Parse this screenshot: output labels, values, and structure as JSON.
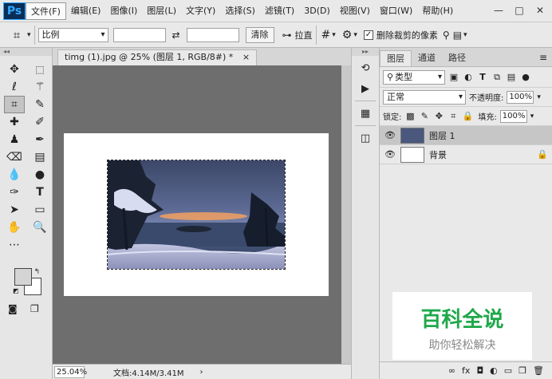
{
  "app": {
    "logo": "Ps"
  },
  "menu": [
    "文件(F)",
    "编辑(E)",
    "图像(I)",
    "图层(L)",
    "文字(Y)",
    "选择(S)",
    "滤镜(T)",
    "3D(D)",
    "视图(V)",
    "窗口(W)",
    "帮助(H)"
  ],
  "window_controls": [
    "—",
    "□",
    "✕"
  ],
  "options": {
    "ratio_select": "比例",
    "clear_button": "清除",
    "straighten_label": "拉直",
    "delete_cropped_label": "删除裁剪的像素",
    "delete_cropped_checked": true
  },
  "document": {
    "tab_title": "timg (1).jpg @ 25% (图层 1, RGB/8#) *",
    "tab_close": "×"
  },
  "status": {
    "zoom": "25.04%",
    "doc_info": "文档:4.14M/3.41M",
    "arrow": "›"
  },
  "panels": {
    "tabs": [
      "图层",
      "通道",
      "路径"
    ],
    "filter_label": "类型",
    "blend_mode": "正常",
    "opacity_label": "不透明度:",
    "opacity_value": "100%",
    "lock_label": "锁定:",
    "fill_label": "填充:",
    "fill_value": "100%",
    "layers": [
      {
        "name": "图层 1",
        "selected": true,
        "visible": true,
        "locked": false
      },
      {
        "name": "背景",
        "selected": false,
        "visible": true,
        "locked": true
      }
    ]
  },
  "watermark": {
    "main": "百科全说",
    "sub": "助你轻松解决"
  },
  "colors": {
    "accent_green": "#1fa84a",
    "ps_blue": "#31a8ff"
  }
}
